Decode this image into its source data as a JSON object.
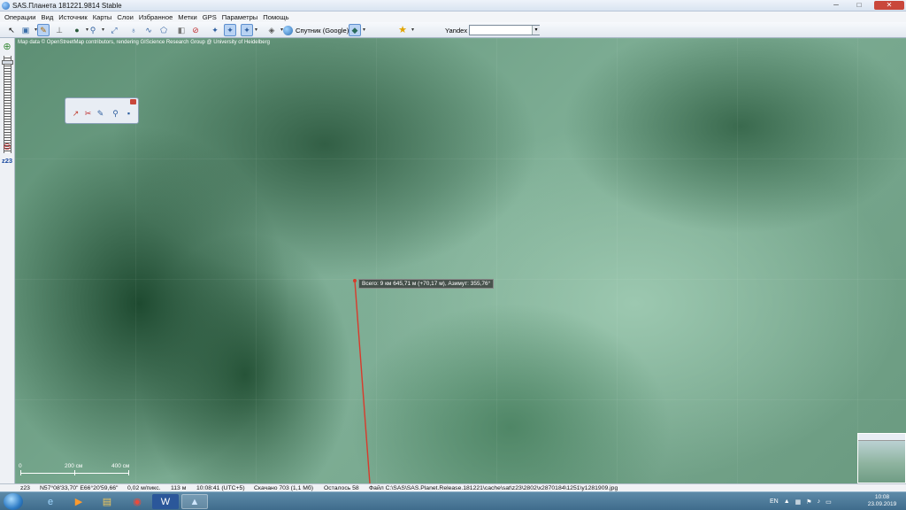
{
  "window": {
    "title": "SAS.Планета 181221.9814 Stable",
    "controls": {
      "minimize": "─",
      "maximize": "□",
      "close": "✕"
    }
  },
  "menu": [
    "Операции",
    "Вид",
    "Источник",
    "Карты",
    "Слои",
    "Избранное",
    "Метки",
    "GPS",
    "Параметры",
    "Помощь"
  ],
  "toolbar": {
    "map_type": "Спутник (Google)",
    "search_provider": "Yandex",
    "search_value": "",
    "icons": [
      "pointer-icon",
      "map-move-icon",
      "ruler-icon",
      "scale-tool-icon",
      "globe-icon",
      "zoom-icon",
      "fullscreen-icon",
      "placemark-icon",
      "path-icon",
      "polygon-icon",
      "marks-icon",
      "stop-icon",
      "gps-icon",
      "gps-track-icon",
      "gps-center-icon",
      "layers-icon",
      "favorites-star-icon"
    ]
  },
  "zoom": {
    "level": "z23"
  },
  "map": {
    "attribution": "Map data © OpenStreetMap contributors, rendering GIScience Research Group @ University of Heidelberg",
    "measure_label": "Всего: 9 км 645,71 м (+70,17 м), Азимут: 355,76°",
    "scale_labels": [
      "0",
      "200 см",
      "400 см"
    ],
    "line_color": "#d93a2b"
  },
  "statusbar": {
    "zoom": "z23",
    "coords": "N57°08'33,70\" E66°20'59,66\"",
    "resolution": "0,02 м/пикс.",
    "altitude": "113 м",
    "time": "10:08:41 (UTC+5)",
    "downloaded": "Скачано 703 (1,1 Мб)",
    "remaining": "Осталось 58",
    "file": "Файл C:\\SAS\\SAS.Planet.Release.181221\\cache\\sat\\z23\\2802\\x2870184\\1251\\y1281909.jpg"
  },
  "taskbar": {
    "apps": [
      "ie-icon",
      "media-player-icon",
      "file-explorer-icon",
      "chrome-icon",
      "word-icon",
      "sas-planet-icon"
    ],
    "lang": "EN",
    "time": "10:08",
    "date": "23.09.2019"
  }
}
